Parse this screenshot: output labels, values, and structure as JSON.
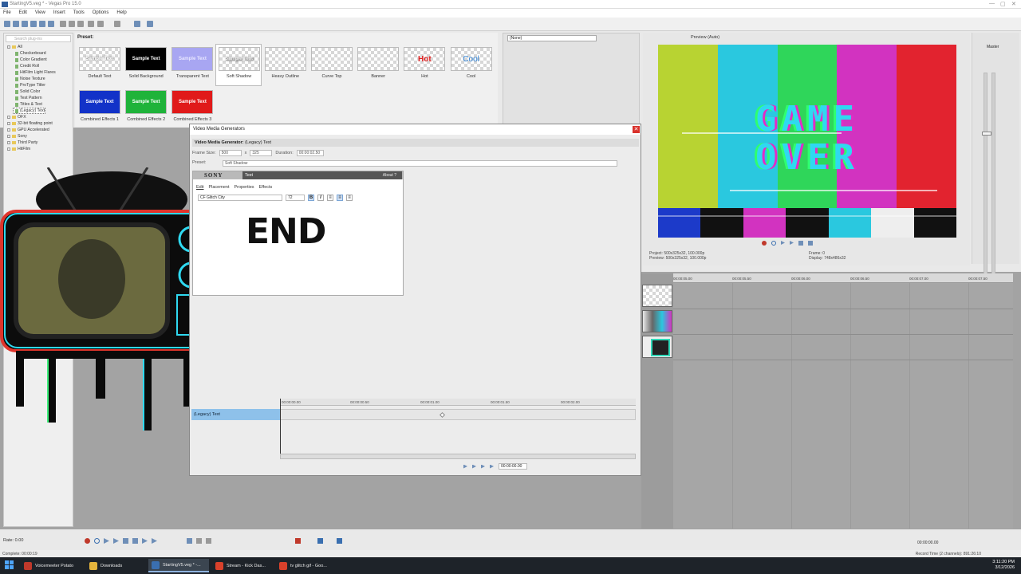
{
  "window": {
    "title": "StartingV5.veg * - Vegas Pro 15.0",
    "controls": [
      "—",
      "▢",
      "✕"
    ]
  },
  "menu": [
    "File",
    "Edit",
    "View",
    "Insert",
    "Tools",
    "Options",
    "Help"
  ],
  "tree": {
    "search_placeholder": "Search plug-ins",
    "items": [
      {
        "label": "All",
        "type": "folder",
        "indent": 0
      },
      {
        "label": "Checkerboard",
        "type": "plugin",
        "indent": 1
      },
      {
        "label": "Color Gradient",
        "type": "plugin",
        "indent": 1
      },
      {
        "label": "Credit Roll",
        "type": "plugin",
        "indent": 1
      },
      {
        "label": "HitFilm Light Flares",
        "type": "plugin",
        "indent": 1
      },
      {
        "label": "Noise Texture",
        "type": "plugin",
        "indent": 1
      },
      {
        "label": "ProType Titler",
        "type": "plugin",
        "indent": 1
      },
      {
        "label": "Solid Color",
        "type": "plugin",
        "indent": 1
      },
      {
        "label": "Test Pattern",
        "type": "plugin",
        "indent": 1
      },
      {
        "label": "Titles & Text",
        "type": "plugin",
        "indent": 1
      },
      {
        "label": "(Legacy) Text",
        "type": "plugin",
        "indent": 1,
        "selected": true
      },
      {
        "label": "OFX",
        "type": "folder",
        "indent": 0
      },
      {
        "label": "32-bit floating point",
        "type": "folder",
        "indent": 0
      },
      {
        "label": "GPU Accelerated",
        "type": "folder",
        "indent": 0
      },
      {
        "label": "Sony",
        "type": "folder",
        "indent": 0
      },
      {
        "label": "Third Party",
        "type": "folder",
        "indent": 0
      },
      {
        "label": "HitFilm",
        "type": "folder",
        "indent": 0
      }
    ]
  },
  "presets": {
    "label": "Preset:",
    "items": [
      {
        "caption": "Default Text",
        "thumb": "Sample Text",
        "style": "checker-white"
      },
      {
        "caption": "Solid Background",
        "thumb": "Sample Text",
        "style": "black"
      },
      {
        "caption": "Transparent Text",
        "thumb": "Sample Text",
        "style": "lavender"
      },
      {
        "caption": "Soft Shadow",
        "thumb": "Sample Text",
        "style": "checker-shadow"
      },
      {
        "caption": "Heavy Outline",
        "thumb": "",
        "style": "checker-cyan"
      },
      {
        "caption": "Curve Top",
        "thumb": "",
        "style": "checker"
      },
      {
        "caption": "Banner",
        "thumb": "",
        "style": "checker"
      },
      {
        "caption": "Hot",
        "thumb": "Hot",
        "style": "checker-hot"
      },
      {
        "caption": "Cool",
        "thumb": "Cool",
        "style": "checker-cool"
      },
      {
        "caption": "Combined Effects 1",
        "thumb": "Sample Text",
        "style": "blue"
      },
      {
        "caption": "Combined Effects 2",
        "thumb": "Sample Text",
        "style": "green"
      },
      {
        "caption": "Combined Effects 3",
        "thumb": "Sample Text",
        "style": "red"
      }
    ]
  },
  "trimmer": {
    "selection": "(None)"
  },
  "preview": {
    "mode_label": "Preview (Auto)",
    "screen_text_line1": "GAME",
    "screen_text_line2": "OVER",
    "project_label": "Project:",
    "project_value": "500x325x32, 100.000p",
    "preview_label": "Preview:",
    "preview_value": "500x325x32, 100.000p",
    "frame_label": "Frame:",
    "frame_value": "0",
    "display_label": "Display:",
    "display_value": "748x486x32"
  },
  "mixer": {
    "label": "Master"
  },
  "timeline": {
    "ruler": [
      "00:00:05.00",
      "00:00:05.50",
      "00:00:06.00",
      "00:00:06.50",
      "00:00:07.00",
      "00:00:07.50"
    ]
  },
  "dialog": {
    "title": "Video Media Generators",
    "close_glyph": "✕",
    "generator_label": "Video Media Generator:",
    "generator_value": "(Legacy) Text",
    "frame_size_label": "Frame Size:",
    "frame_w": "500",
    "x_label": "x",
    "frame_h": "325",
    "duration_label": "Duration:",
    "duration_value": "00:00:02.50",
    "preset_label": "Preset:",
    "preset_value": "Soft Shadow",
    "plugin": {
      "brand": "SONY",
      "tab": "Text",
      "about": "About ?",
      "tabs": [
        "Edit",
        "Placement",
        "Properties",
        "Effects"
      ],
      "font": "CF Glitch City",
      "size": "72",
      "bold": "B",
      "italic": "I",
      "text": "END"
    },
    "keyframes": {
      "track_label": "(Legacy) Text",
      "ruler": [
        "00:00:00.00",
        "00:00:00.50",
        "00:00:01.00",
        "00:00:01.50",
        "00:00:02.00"
      ],
      "time_value": "00:00:00.00"
    }
  },
  "transport": {
    "rate": "Rate: 0.00"
  },
  "status": {
    "left": "Complete: 00:00:19",
    "right": "Record Time (2 channels): 891:26:10",
    "time_right": "00:00:00.00"
  },
  "taskbar": {
    "items": [
      {
        "label": "Voicemeeter Potato",
        "color": "#c0392b"
      },
      {
        "label": "Downloads",
        "color": "#e5b43c"
      },
      {
        "label": "StartingV5.veg * -...",
        "color": "#3a6fb0",
        "active": true
      },
      {
        "label": "Stream - Kick Das...",
        "color": "#d9412b"
      },
      {
        "label": "tv glitch gif - Goo...",
        "color": "#d9412b"
      }
    ],
    "time": "3:11:20 PM",
    "date": "3/12/2026"
  },
  "colors": {
    "accent": "#8ec1ea",
    "close_red": "#d9312b",
    "taskbar": "#1e2329"
  }
}
